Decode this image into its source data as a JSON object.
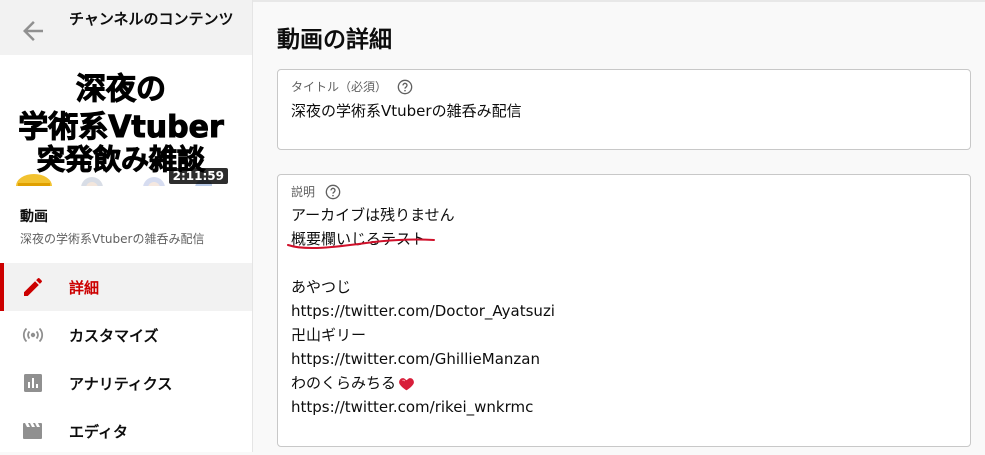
{
  "sidebar": {
    "header_title": "チャンネルのコンテンツ",
    "thumbnail": {
      "lines": [
        "深夜の",
        "学術系Vtuber",
        "突発飲み雑談"
      ],
      "duration": "2:11:59"
    },
    "section_title": "動画",
    "section_subtitle": "深夜の学術系Vtuberの雑呑み配信",
    "nav": [
      {
        "label": "詳細",
        "icon": "pencil-icon",
        "active": true
      },
      {
        "label": "カスタマイズ",
        "icon": "broadcast-icon",
        "active": false
      },
      {
        "label": "アナリティクス",
        "icon": "analytics-icon",
        "active": false
      },
      {
        "label": "エディタ",
        "icon": "clapperboard-icon",
        "active": false
      }
    ]
  },
  "main": {
    "page_title": "動画の詳細",
    "title_field": {
      "label": "タイトル（必須）",
      "value": "深夜の学術系Vtuberの雑呑み配信"
    },
    "description_field": {
      "label": "説明",
      "lines": [
        "アーカイブは残りません",
        "概要欄いじるテスト",
        "",
        "あやつじ",
        "https://twitter.com/Doctor_Ayatsuzi",
        "卍山ギリー",
        "https://twitter.com/GhillieManzan",
        "わのくらみちる",
        "https://twitter.com/rikei_wnkrmc"
      ]
    }
  },
  "colors": {
    "accent_red": "#cc0000",
    "underline_red": "#d0112b",
    "heart": "#d81e3a"
  }
}
